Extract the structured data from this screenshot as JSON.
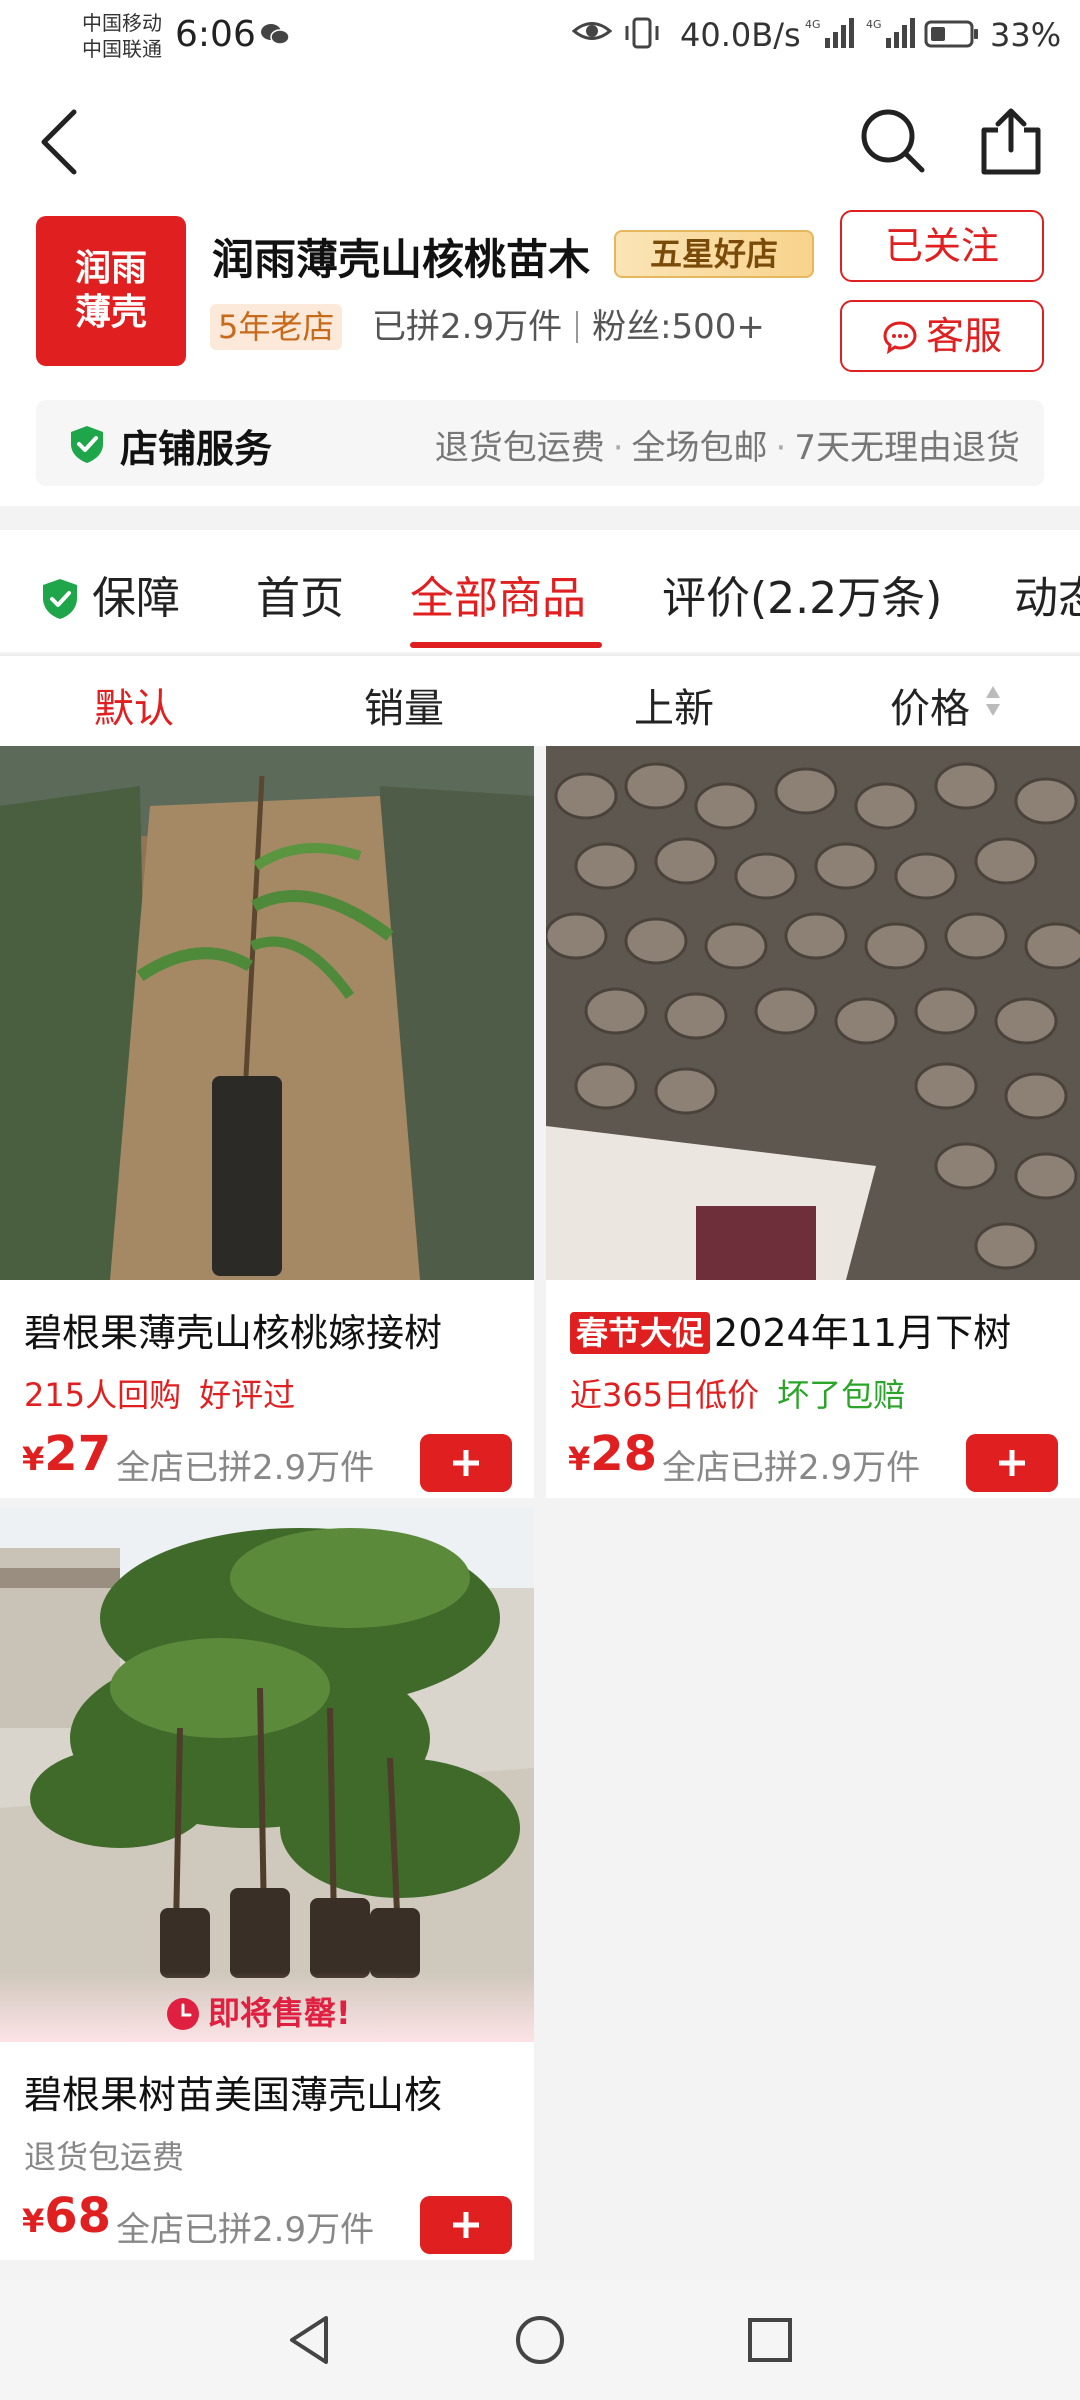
{
  "status_bar": {
    "carrier_1": "中国移动",
    "carrier_2": "中国联通",
    "time": "6:06",
    "net_speed": "40.0B/s",
    "battery": "33%"
  },
  "shop": {
    "logo_text": "润雨薄壳",
    "name": "润雨薄壳山核桃苗木",
    "star_badge": "五星好店",
    "age_badge": "5年老店",
    "sold": "已拼2.9万件",
    "fans": "粉丝:500+",
    "follow_label": "已关注",
    "service_label": "客服",
    "service_bar": {
      "title": "店铺服务",
      "items": [
        "退货包运费",
        "全场包邮",
        "7天无理由退货"
      ]
    }
  },
  "tabs": [
    "保障",
    "首页",
    "全部商品",
    "评价(2.2万条)",
    "动态"
  ],
  "active_tab": "全部商品",
  "sort": [
    "默认",
    "销量",
    "上新",
    "价格"
  ],
  "active_sort": "默认",
  "products": [
    {
      "title": "碧根果薄壳山核桃嫁接树",
      "promo": "",
      "tags": [
        "215人回购",
        "好评过"
      ],
      "price_symbol": "¥",
      "price": "27",
      "sold": "全店已拼2.9万件"
    },
    {
      "title": "2024年11月下树",
      "promo": "春节大促",
      "tags": [
        "近365日低价",
        "坏了包赔"
      ],
      "price_symbol": "¥",
      "price": "28",
      "sold": "全店已拼2.9万件"
    },
    {
      "title": "碧根果树苗美国薄壳山核",
      "promo": "",
      "tags": [
        "退货包运费"
      ],
      "price_symbol": "¥",
      "price": "68",
      "sold": "全店已拼2.9万件",
      "overlay": "即将售罄!"
    }
  ],
  "colors": {
    "accent": "#e02020",
    "green": "#2aa52a",
    "star_badge_bg": "#f8d38c"
  },
  "icons": [
    "back-icon",
    "search-icon",
    "share-icon",
    "chat-icon",
    "shield-icon",
    "plus-icon",
    "clock-icon",
    "nav-back-icon",
    "nav-home-icon",
    "nav-recent-icon"
  ]
}
